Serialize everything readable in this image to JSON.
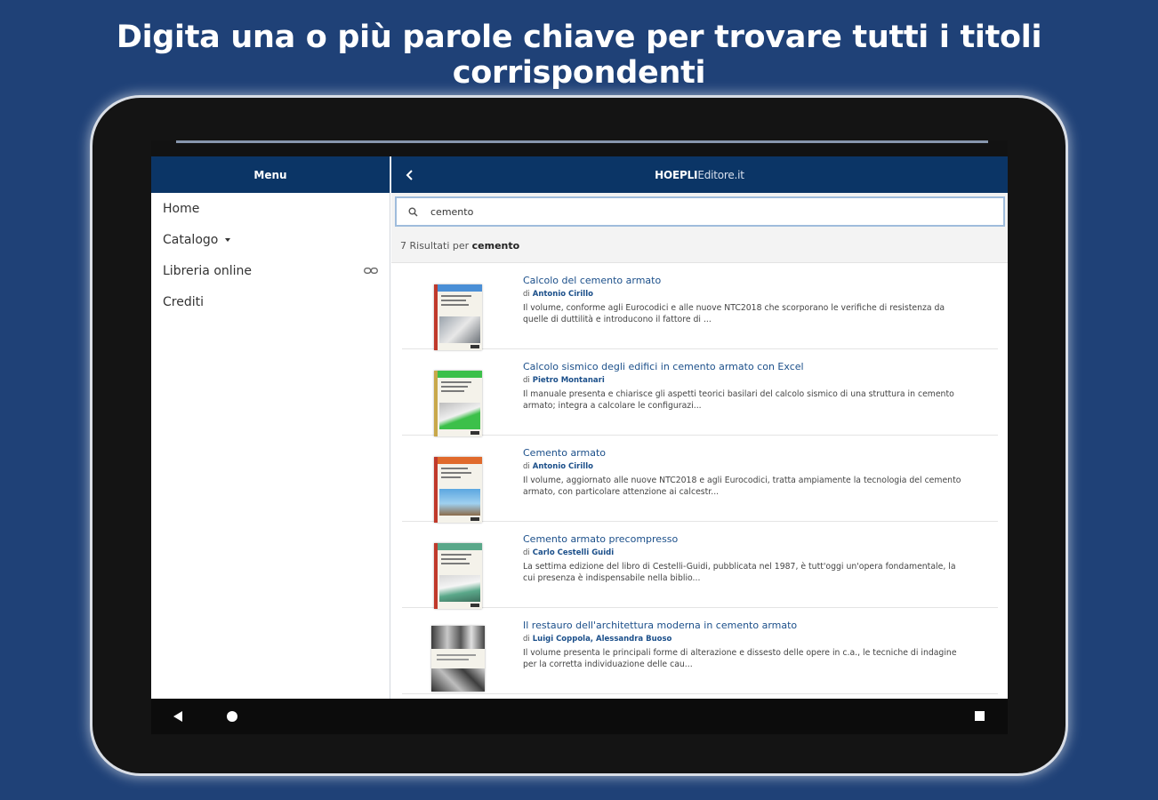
{
  "headline": "Digita una o più parole chiave per trovare tutti i titoli corrispondenti",
  "drawer": {
    "title": "Menu",
    "items": [
      {
        "label": "Home"
      },
      {
        "label": "Catalogo"
      },
      {
        "label": "Libreria online"
      },
      {
        "label": "Crediti"
      }
    ]
  },
  "topbar": {
    "brand_bold": "HOEPLI",
    "brand_light": "Editore.it"
  },
  "search": {
    "value": "cemento",
    "results_prefix": "7 Risultati per",
    "results_term": "cemento"
  },
  "results": [
    {
      "title": "Calcolo del cemento armato",
      "by": "di",
      "author": "Antonio Cirillo",
      "description": "Il volume, conforme agli Eurocodici e alle nuove NTC2018 che scorporano le verifiche di resistenza da quelle di duttilità e introducono il fattore di ...",
      "cover_color": "#4a8fd6"
    },
    {
      "title": "Calcolo sismico degli edifici in cemento armato con Excel",
      "by": "di",
      "author": "Pietro Montanari",
      "description": "Il manuale presenta e chiarisce gli aspetti teorici basilari del calcolo sismico di una struttura in cemento armato; integra a calcolare le configurazi...",
      "cover_color": "#3cc04a"
    },
    {
      "title": "Cemento armato",
      "by": "di",
      "author": "Antonio Cirillo",
      "description": "Il volume, aggiornato alle nuove NTC2018 e agli Eurocodici, tratta ampiamente la tecnologia del cemento armato, con particolare attenzione ai calcestr...",
      "cover_color": "#e06a2c"
    },
    {
      "title": "Cemento armato precompresso",
      "by": "di",
      "author": "Carlo Cestelli Guidi",
      "description": "La settima edizione del libro di Cestelli-Guidi, pubblicata nel 1987, è tutt'oggi un'opera fondamentale, la cui presenza è indispensabile nella biblio...",
      "cover_color": "#5aa88a"
    },
    {
      "title": "Il restauro dell'architettura moderna in cemento armato",
      "by": "di",
      "author": "Luigi Coppola, Alessandra Buoso",
      "description": "Il volume presenta le principali forme di alterazione e dissesto delle opere in c.a., le tecniche di indagine per la corretta individuazione delle cau...",
      "cover_color": "#666666"
    }
  ],
  "icons": {
    "back": "chevron-left-icon",
    "search": "search-icon",
    "link": "link-icon",
    "caret": "caret-down-icon"
  }
}
